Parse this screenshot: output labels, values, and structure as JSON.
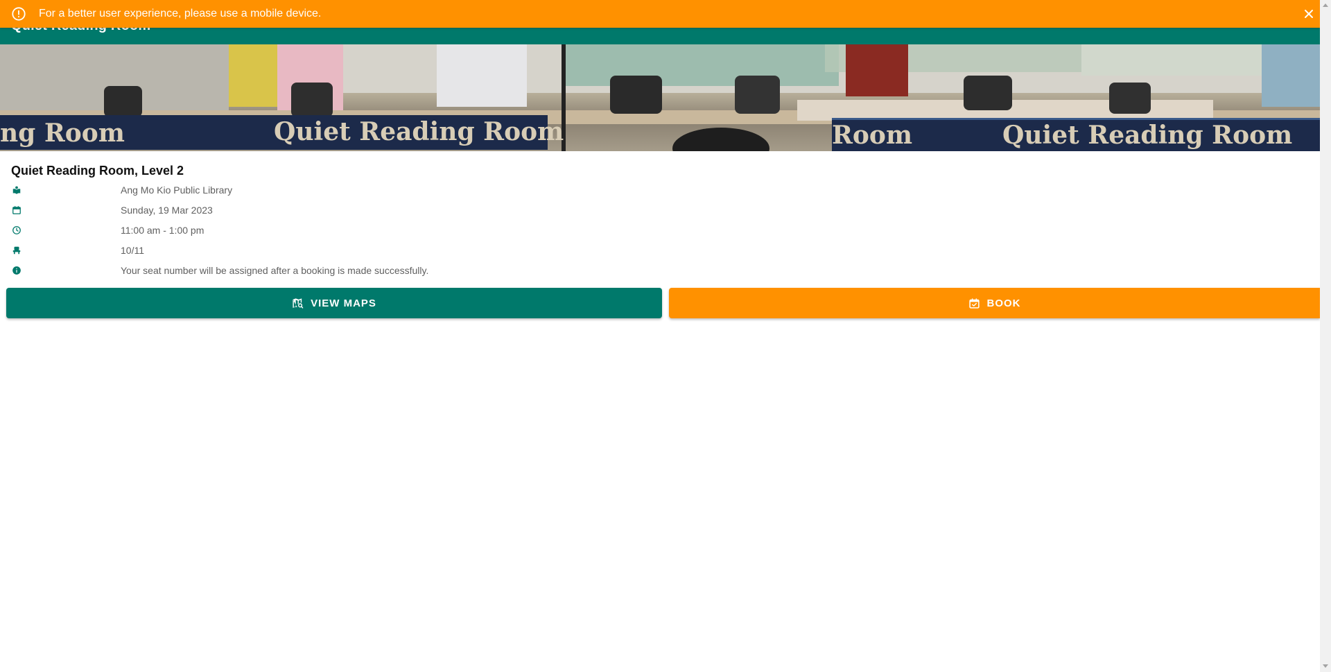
{
  "appbar": {
    "title": "Quiet Reading Room"
  },
  "alert": {
    "message": "For a better user experience, please use a mobile device.",
    "icon": "alert-circle-icon",
    "close_icon": "close-icon",
    "color": "#ff9100"
  },
  "banner": {
    "signs": [
      "ng Room",
      "Quiet Reading Room",
      "Room",
      "Quiet Reading Room"
    ]
  },
  "room": {
    "title": "Quiet Reading Room, Level 2",
    "details": [
      {
        "icon": "library-icon",
        "value": "Ang Mo Kio Public Library"
      },
      {
        "icon": "calendar-icon",
        "value": "Sunday, 19 Mar 2023"
      },
      {
        "icon": "clock-icon",
        "value": "11:00 am - 1:00 pm"
      },
      {
        "icon": "seat-icon",
        "value": "10/11"
      },
      {
        "icon": "info-icon",
        "value": "Your seat number will be assigned after a booking is made successfully."
      }
    ]
  },
  "actions": {
    "view_maps": {
      "label": "VIEW MAPS",
      "icon": "map-search-icon"
    },
    "book": {
      "label": "BOOK",
      "icon": "calendar-check-icon"
    }
  },
  "colors": {
    "primary": "#00796b",
    "accent": "#ff9100"
  }
}
